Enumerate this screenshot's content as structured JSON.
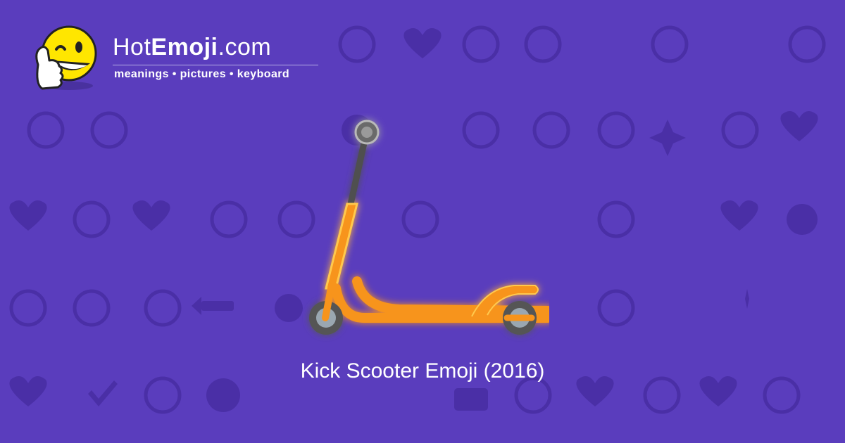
{
  "brand": {
    "name_prefix": "Hot",
    "name_bold": "Emoji",
    "name_suffix": ".com",
    "tagline": "meanings • pictures • keyboard",
    "mascot_icon": "winking-thumbs-up-smiley-icon"
  },
  "hero": {
    "icon": "kick-scooter-icon",
    "colors": {
      "frame": "#f7941d",
      "glow": "#ffc94d",
      "wheel": "#555555",
      "hub": "#9aa7b1"
    }
  },
  "caption": "Kick Scooter Emoji (2016)",
  "theme": {
    "background": "#5a3dbd",
    "pattern": "#4a2fa6"
  }
}
